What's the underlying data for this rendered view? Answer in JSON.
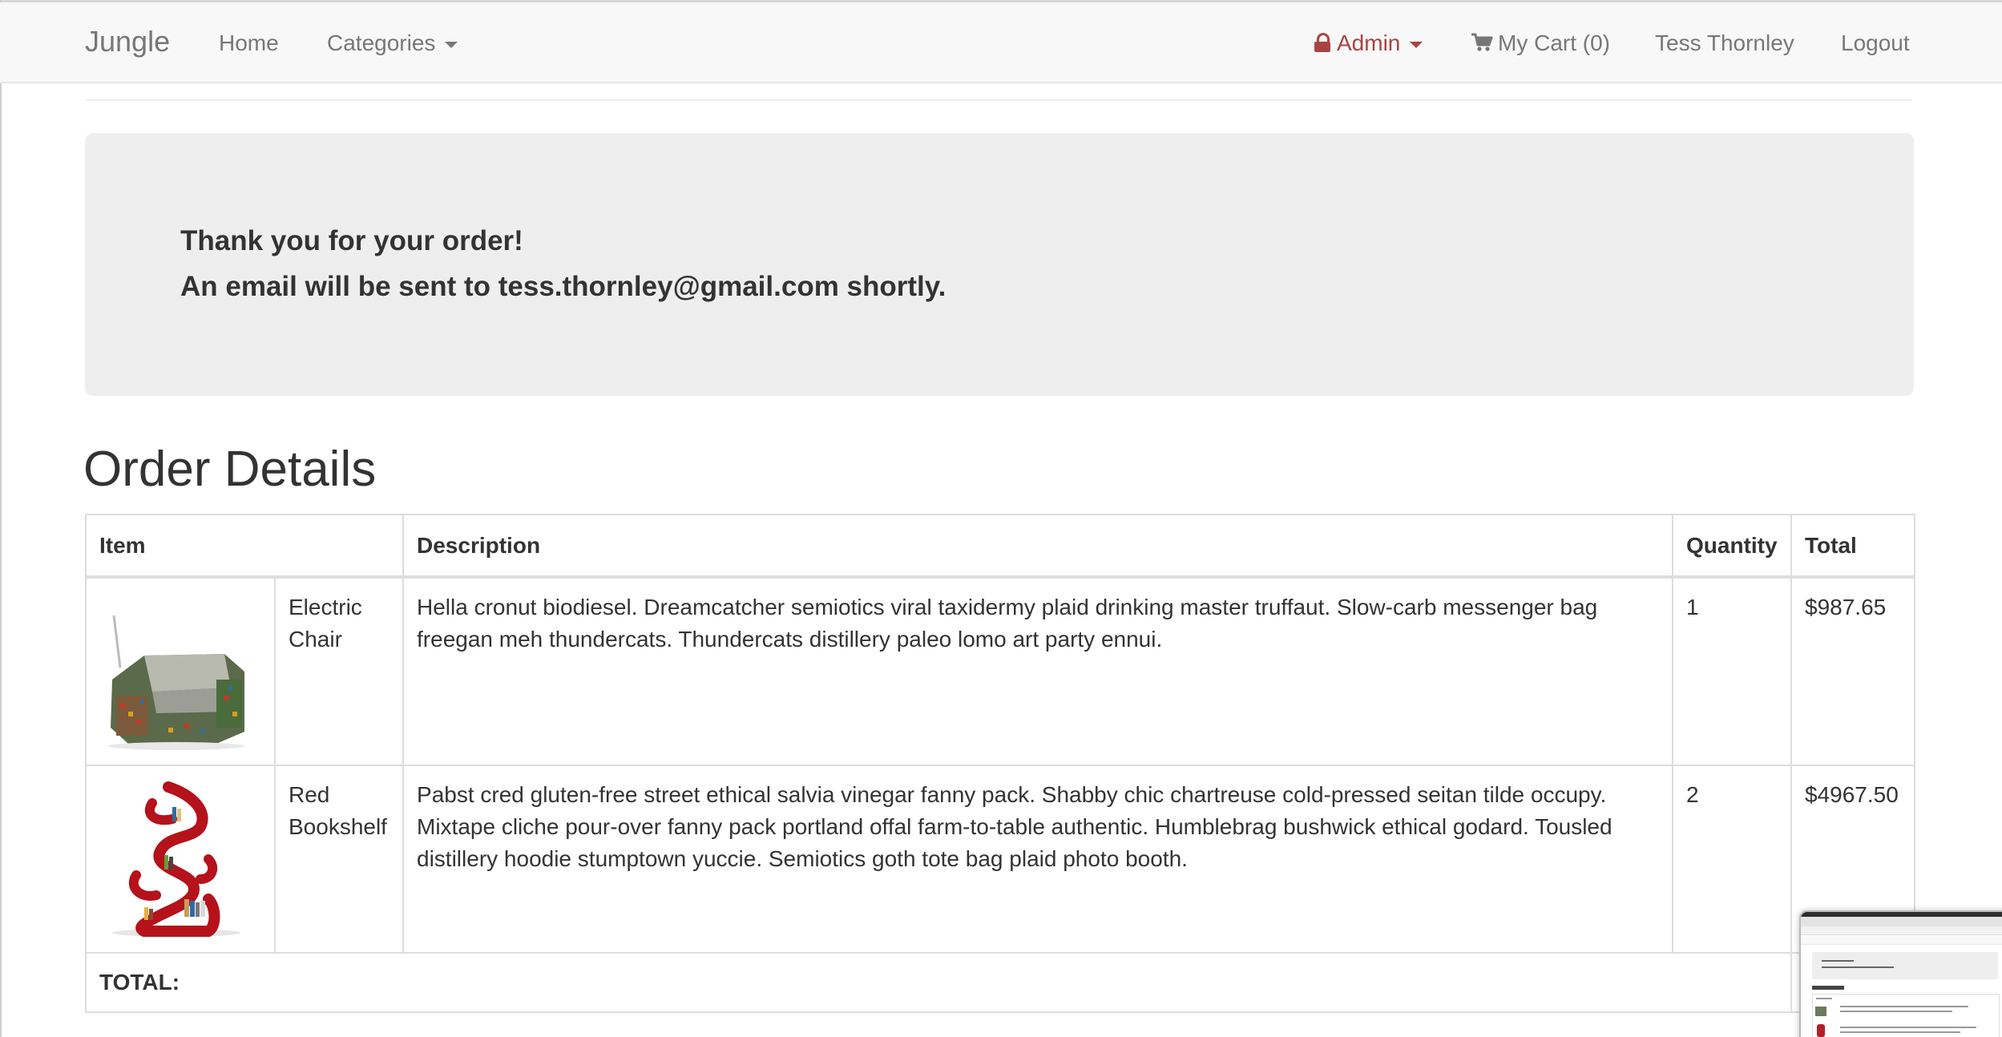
{
  "navbar": {
    "brand": "Jungle",
    "home": "Home",
    "categories": "Categories",
    "admin": "Admin",
    "cart": "My Cart (0)",
    "user": "Tess Thornley",
    "logout": "Logout"
  },
  "confirmation": {
    "line1": "Thank you for your order!",
    "line2": "An email will be sent to tess.thornley@gmail.com shortly."
  },
  "order": {
    "title": "Order Details",
    "headers": {
      "item": "Item",
      "description": "Description",
      "quantity": "Quantity",
      "total": "Total"
    },
    "items": [
      {
        "name": "Electric Chair",
        "description": "Hella cronut biodiesel. Dreamcatcher semiotics viral taxidermy plaid drinking master truffaut. Slow-carb messenger bag freegan meh thundercats. Thundercats distillery paleo lomo art party ennui.",
        "quantity": "1",
        "total": "$987.65"
      },
      {
        "name": "Red Bookshelf",
        "description": "Pabst cred gluten-free street ethical salvia vinegar fanny pack. Shabby chic chartreuse cold-pressed seitan tilde occupy. Mixtape cliche pour-over fanny pack portland offal farm-to-table authentic. Humblebrag bushwick ethical godard. Tousled distillery hoodie stumptown yuccie. Semiotics goth tote bag plaid photo booth.",
        "quantity": "2",
        "total": "$4967.50"
      }
    ],
    "total_label": "TOTAL:"
  },
  "icons": {
    "admin": "lock-icon",
    "cart": "cart-icon",
    "dropdown": "caret-down-icon"
  },
  "colors": {
    "admin_accent": "#a94442",
    "navbar_bg": "#f8f8f8",
    "jumbotron_bg": "#eeeeee",
    "nav_text": "#777777"
  }
}
